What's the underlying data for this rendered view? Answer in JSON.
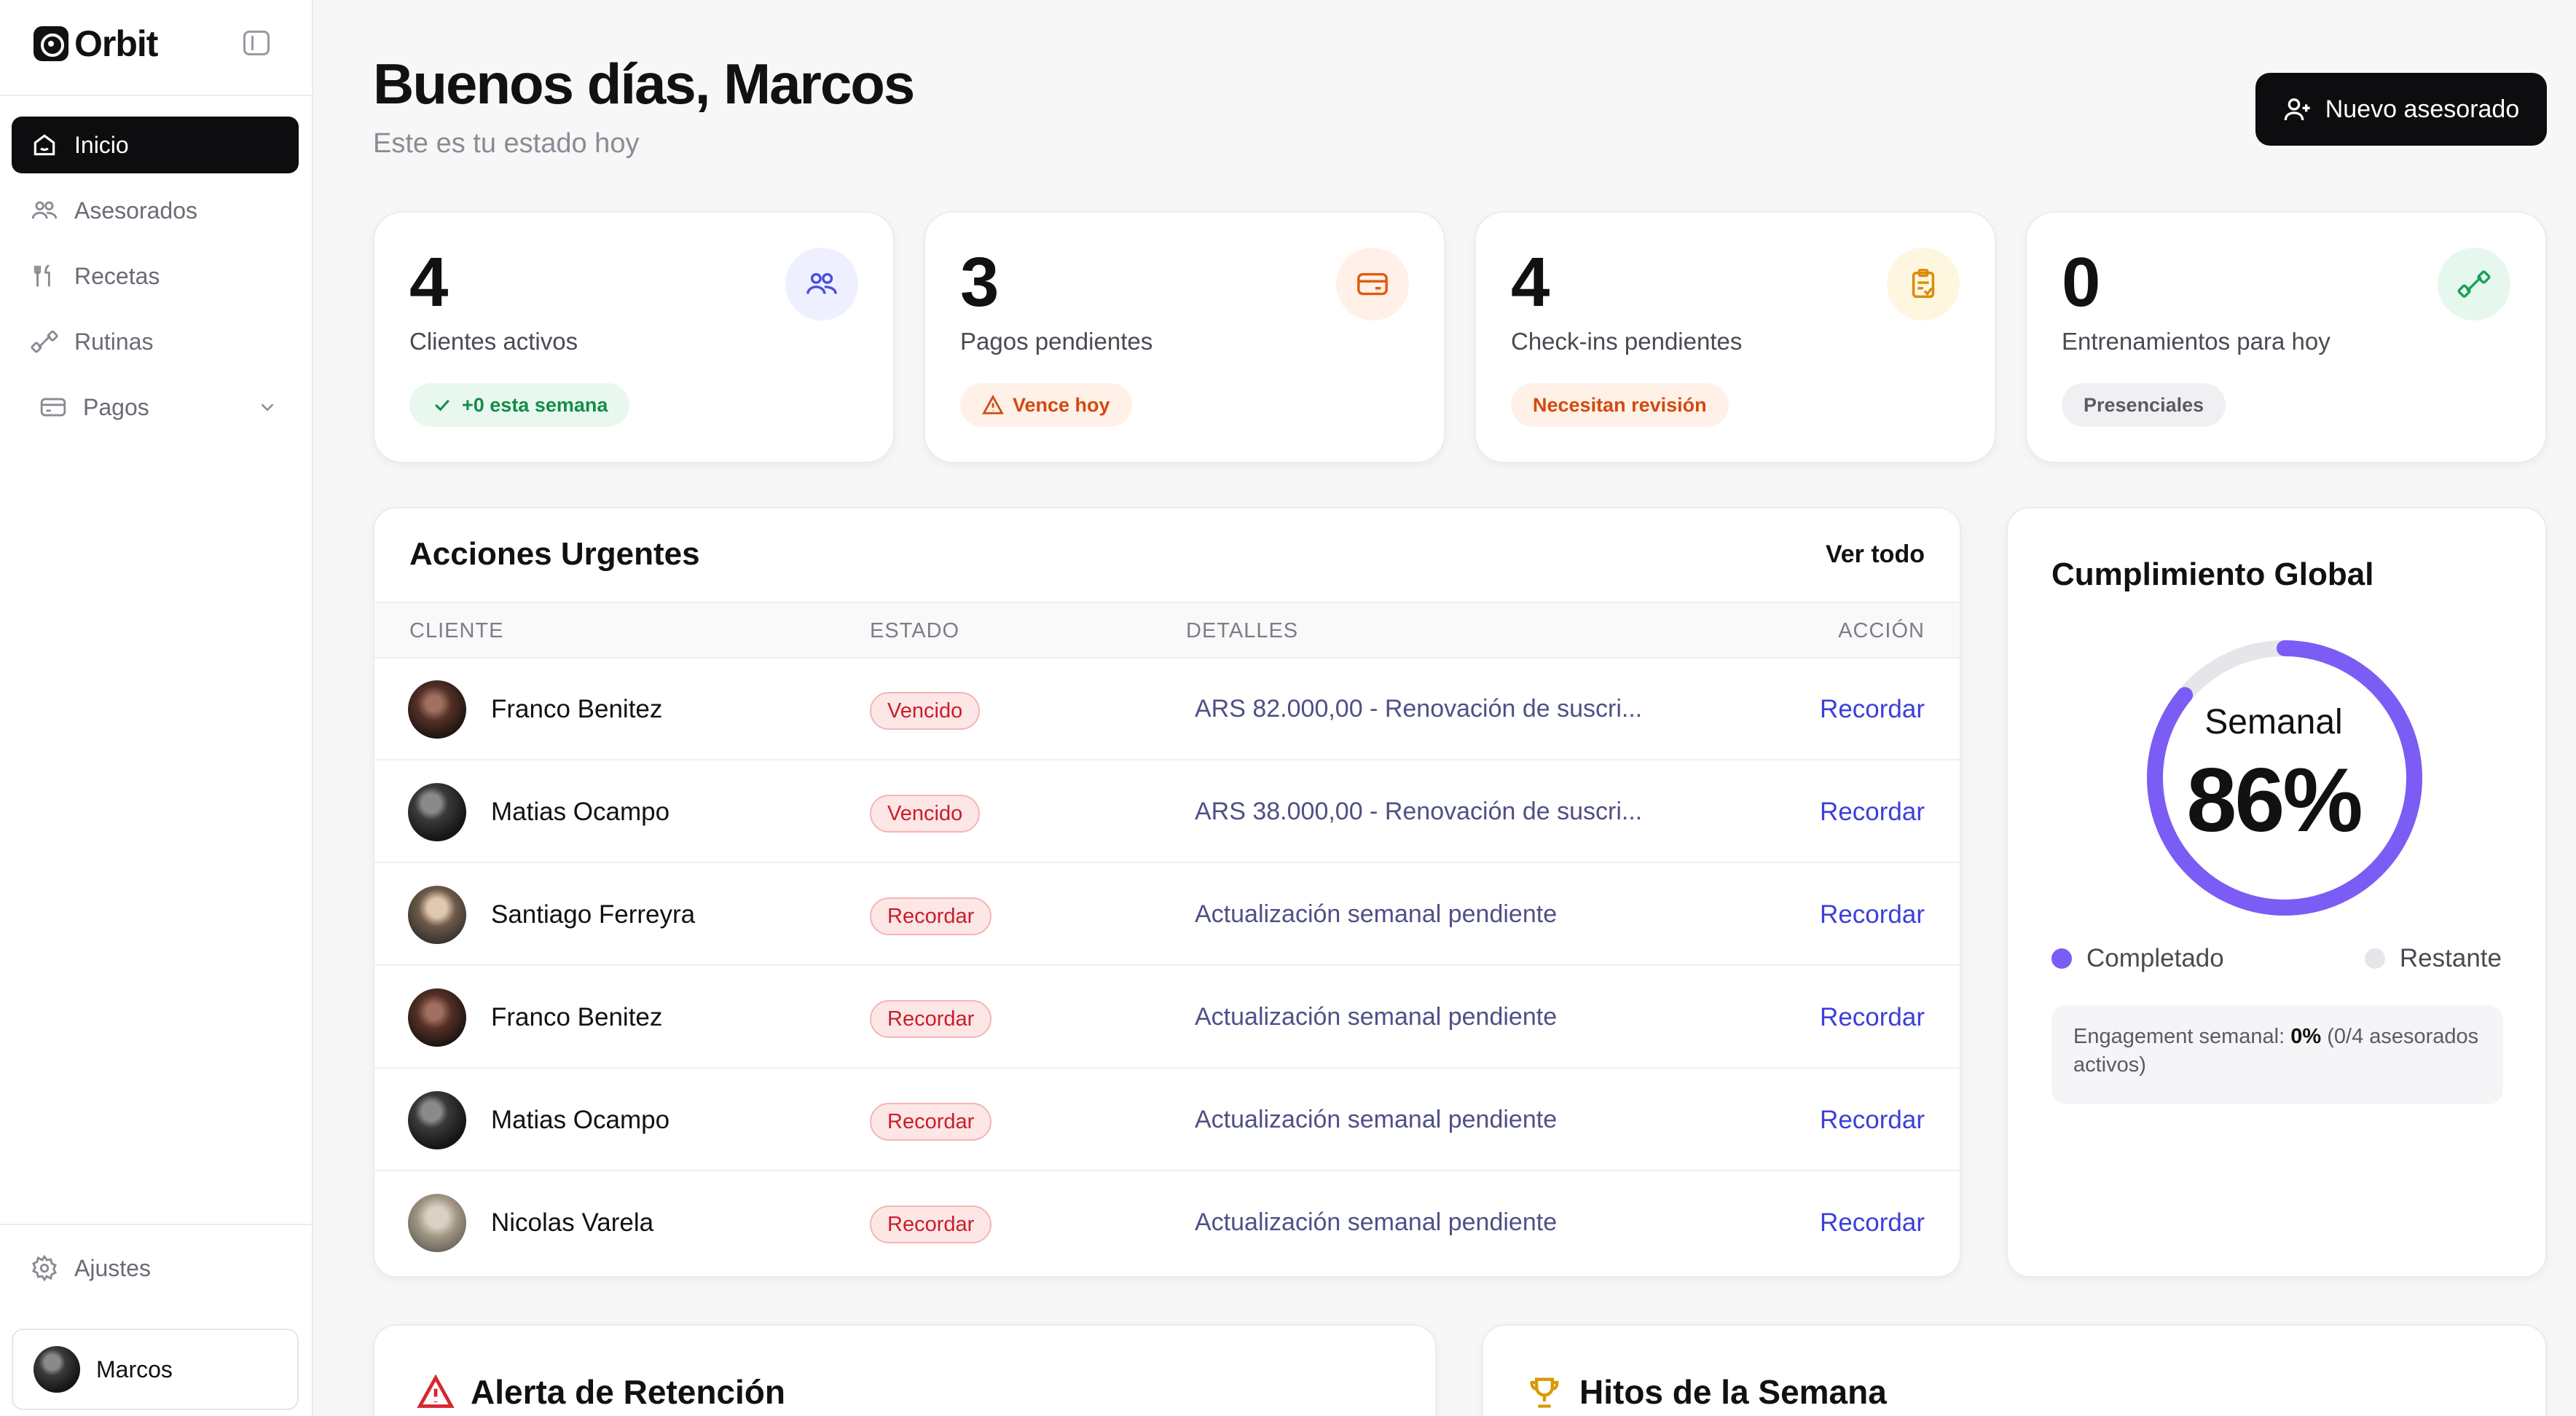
{
  "sidebar": {
    "brand": "Orbit",
    "items": [
      {
        "label": "Inicio",
        "icon": "home-icon"
      },
      {
        "label": "Asesorados",
        "icon": "users-icon"
      },
      {
        "label": "Recetas",
        "icon": "utensils-icon"
      },
      {
        "label": "Rutinas",
        "icon": "dumbbell-icon"
      },
      {
        "label": "Pagos",
        "icon": "credit-card-icon"
      }
    ],
    "settings": "Ajustes",
    "user": "Marcos"
  },
  "header": {
    "greeting": "Buenos días, ",
    "name": "Marcos",
    "subtitle": "Este es tu estado hoy",
    "new_button": "Nuevo asesorado"
  },
  "stats": [
    {
      "value": "4",
      "label": "Clientes activos",
      "pill": "+0 esta semana"
    },
    {
      "value": "3",
      "label": "Pagos pendientes",
      "pill": "Vence hoy"
    },
    {
      "value": "4",
      "label": "Check-ins pendientes",
      "pill": "Necesitan revisión"
    },
    {
      "value": "0",
      "label": "Entrenamientos para hoy",
      "pill": "Presenciales"
    }
  ],
  "urgent": {
    "title": "Acciones Urgentes",
    "view_all": "Ver todo",
    "columns": [
      "CLIENTE",
      "ESTADO",
      "DETALLES",
      "ACCIÓN"
    ],
    "rows": [
      {
        "client": "Franco Benitez",
        "status": "Vencido",
        "details": "ARS 82.000,00 - Renovación de suscri...",
        "action": "Recordar"
      },
      {
        "client": "Matias Ocampo",
        "status": "Vencido",
        "details": "ARS 38.000,00 - Renovación de suscri...",
        "action": "Recordar"
      },
      {
        "client": "Santiago Ferreyra",
        "status": "Recordar",
        "details": "Actualización semanal pendiente",
        "action": "Recordar"
      },
      {
        "client": "Franco Benitez",
        "status": "Recordar",
        "details": "Actualización semanal pendiente",
        "action": "Recordar"
      },
      {
        "client": "Matias Ocampo",
        "status": "Recordar",
        "details": "Actualización semanal pendiente",
        "action": "Recordar"
      },
      {
        "client": "Nicolas Varela",
        "status": "Recordar",
        "details": "Actualización semanal pendiente",
        "action": "Recordar"
      }
    ]
  },
  "global": {
    "title": "Cumplimiento Global",
    "ring_label": "Semanal",
    "percent_text": "86%",
    "percent": 86,
    "legend_done": "Completado",
    "legend_rest": "Restante",
    "engagement_prefix": "Engagement semanal: ",
    "engagement_value": "0%",
    "engagement_suffix": " (0/4 asesorados activos)"
  },
  "bottom": {
    "retention_title": "Alerta de Retención",
    "milestones_title": "Hitos de la Semana"
  },
  "colors": {
    "accent": "#7b5cf5",
    "ring_track": "#e5e5ea",
    "danger": "#c81e2a",
    "link": "#3b3fd8"
  }
}
